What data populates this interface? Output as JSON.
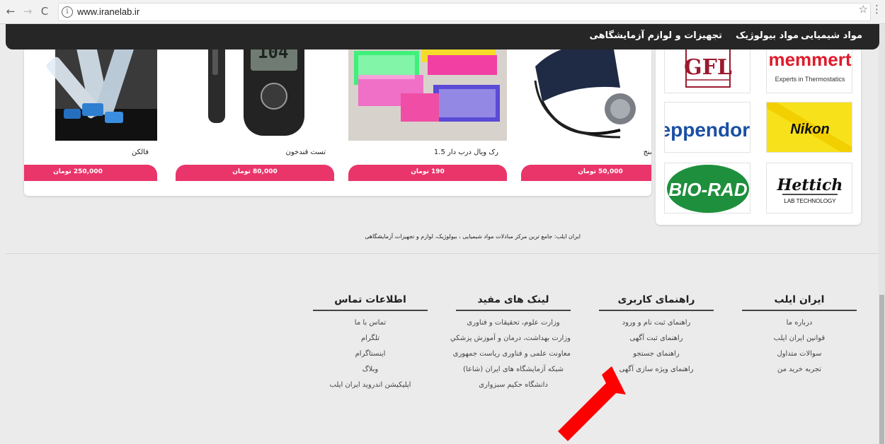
{
  "browser": {
    "url": "www.iranelab.ir",
    "back_icon": "←",
    "forward_icon": "→",
    "reload_icon": "C",
    "info_icon": "i",
    "star_icon": "☆",
    "menu_icon": "⋮"
  },
  "nav": {
    "items": [
      "مواد شیمیایی",
      "مواد بیولوژیک",
      "تجهیزات و لوازم آزمایشگاهی"
    ]
  },
  "products": [
    {
      "name": "فالکن",
      "price": "250,000 تومان"
    },
    {
      "name": "تست قندخون",
      "price": "80,000 تومان"
    },
    {
      "name": "رک ویال درب دار 1.5",
      "price": "190 تومان"
    },
    {
      "name": "فشارسنج",
      "price": "50,000 تومان"
    }
  ],
  "brands": {
    "gfl": "GFL",
    "memmert": "memmert",
    "memmert_sub": "Experts in Thermostatics",
    "eppendorf": "eppendorf",
    "nikon": "Nikon",
    "biorad": "BIO-RAD",
    "hettich": "Hettich",
    "hettich_sub": "LAB TECHNOLOGY"
  },
  "glucometer_display": "104",
  "tagline": "ایران ایلب: جامع ترین مرکز مبادلات مواد شیمیایی ، بیولوژیک، لوازم و تجهیزات آزمایشگاهی",
  "footer": {
    "columns": [
      {
        "title": "ایران ایلب",
        "links": [
          "درباره ما",
          "قوانین ایران ایلب",
          "سوالات متداول",
          "تجربه خرید من"
        ]
      },
      {
        "title": "راهنمای کاربری",
        "links": [
          "راهنمای ثبت نام و ورود",
          "راهنمای ثبت آگهی",
          "راهنمای جستجو",
          "راهنمای ویژه سازی آگهی"
        ]
      },
      {
        "title": "لینک های مفید",
        "links": [
          "وزارت علوم، تحقیقات و فناوری",
          "وزارت بهداشت، درمان و آموزش پزشکي",
          "معاونت علمی و فناوری ریاست جمهوری",
          "شبکه آزمایشگاه های ایران (شاعا)",
          "دانشگاه حکیم سبزواری"
        ]
      },
      {
        "title": "اطلاعات تماس",
        "links": [
          "تماس با ما",
          "تلگرام",
          "اینستاگرام",
          "وبلاگ",
          "اپلیکیشن اندروید ایران ایلب"
        ]
      }
    ]
  },
  "colors": {
    "price_bar": "#e9356a",
    "navbar": "#262626",
    "arrow": "#ff0000"
  }
}
